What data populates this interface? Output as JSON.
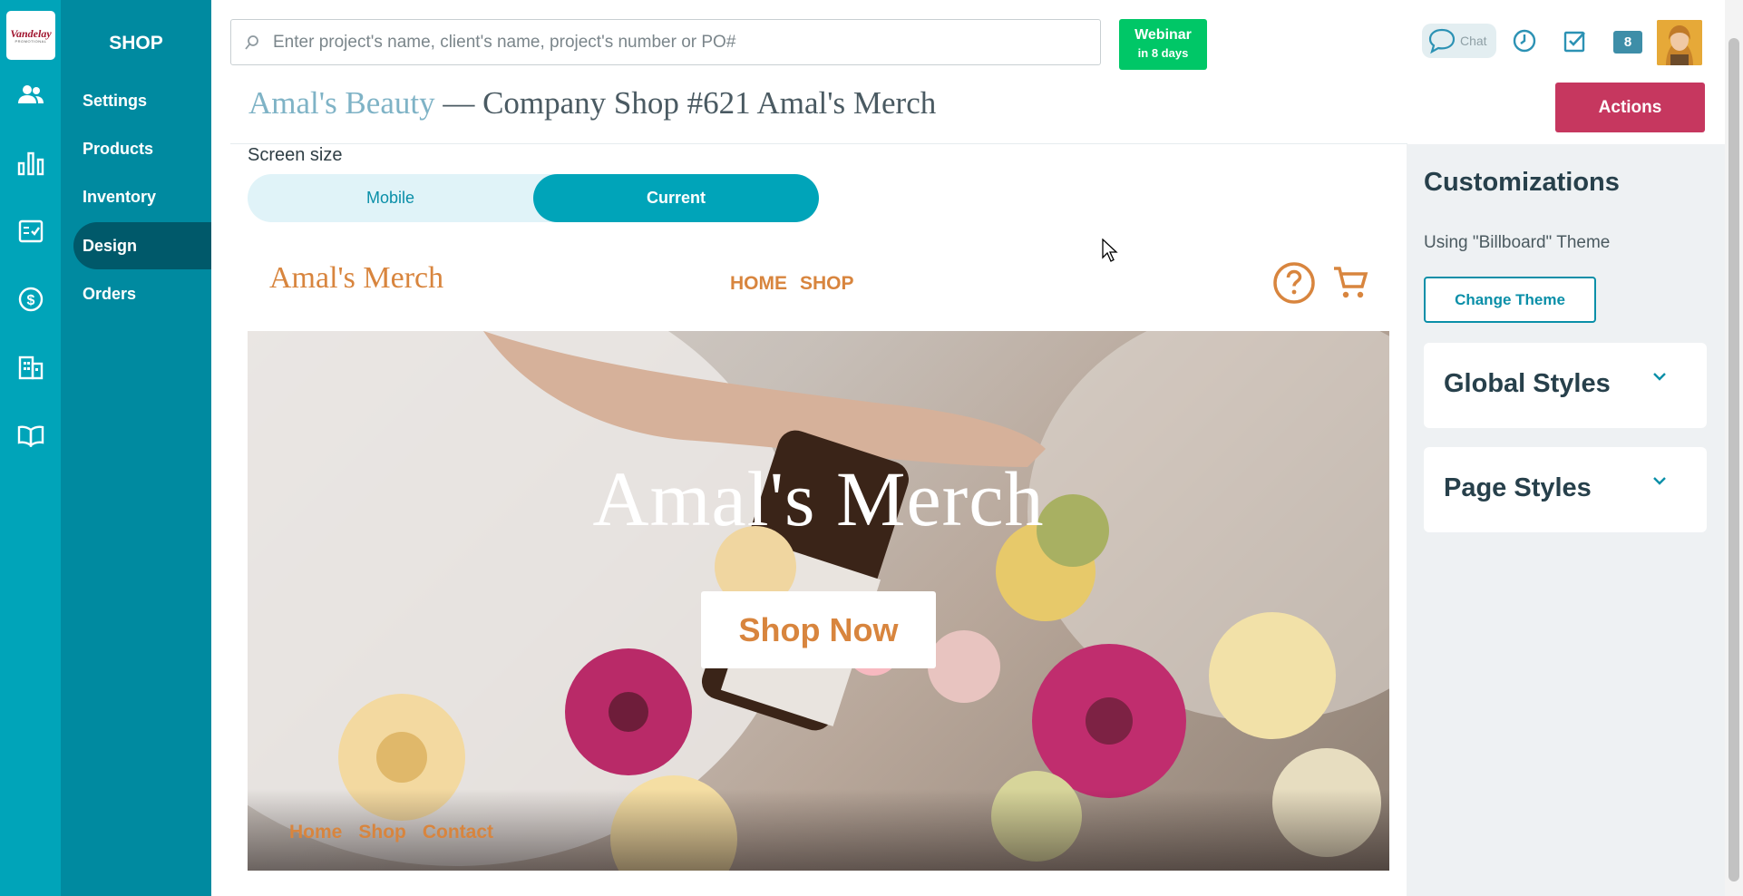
{
  "rail": {
    "logo_text": "Vandelay",
    "logo_sub": "PROMOTIONAL",
    "icons": [
      "clients-icon",
      "reports-icon",
      "tasks-icon",
      "billing-icon",
      "companies-icon",
      "resources-icon"
    ]
  },
  "shopnav": {
    "title": "SHOP",
    "items": [
      {
        "label": "Settings"
      },
      {
        "label": "Products"
      },
      {
        "label": "Inventory"
      },
      {
        "label": "Design"
      },
      {
        "label": "Orders"
      }
    ],
    "active": "Design"
  },
  "header": {
    "search_placeholder": "Enter project's name, client's name, project's number or PO#",
    "webinar_title": "Webinar",
    "webinar_sub": "in 8 days",
    "chat_label": "Chat",
    "badge_count": "8"
  },
  "breadcrumb": {
    "client": "Amal's Beauty",
    "separator": " — ",
    "title": "Company Shop #621 Amal's Merch"
  },
  "actions_label": "Actions",
  "screen_size": {
    "label": "Screen size",
    "options": [
      "Mobile",
      "Current"
    ],
    "selected": "Current"
  },
  "store": {
    "name": "Amal's Merch",
    "nav": [
      "HOME",
      "SHOP"
    ],
    "hero_title": "Amal's Merch",
    "hero_button": "Shop Now",
    "footer_links": [
      "Home",
      "Shop",
      "Contact"
    ]
  },
  "panel": {
    "title": "Customizations",
    "theme_text": "Using \"Billboard\" Theme",
    "change_theme": "Change Theme",
    "sections": [
      "Global Styles",
      "Page Styles"
    ]
  },
  "colors": {
    "teal": "#00a4b9",
    "teal_dark": "#008aa0",
    "orange": "#d8853e",
    "actions_red": "#c6375f",
    "webinar_green": "#00c767"
  }
}
